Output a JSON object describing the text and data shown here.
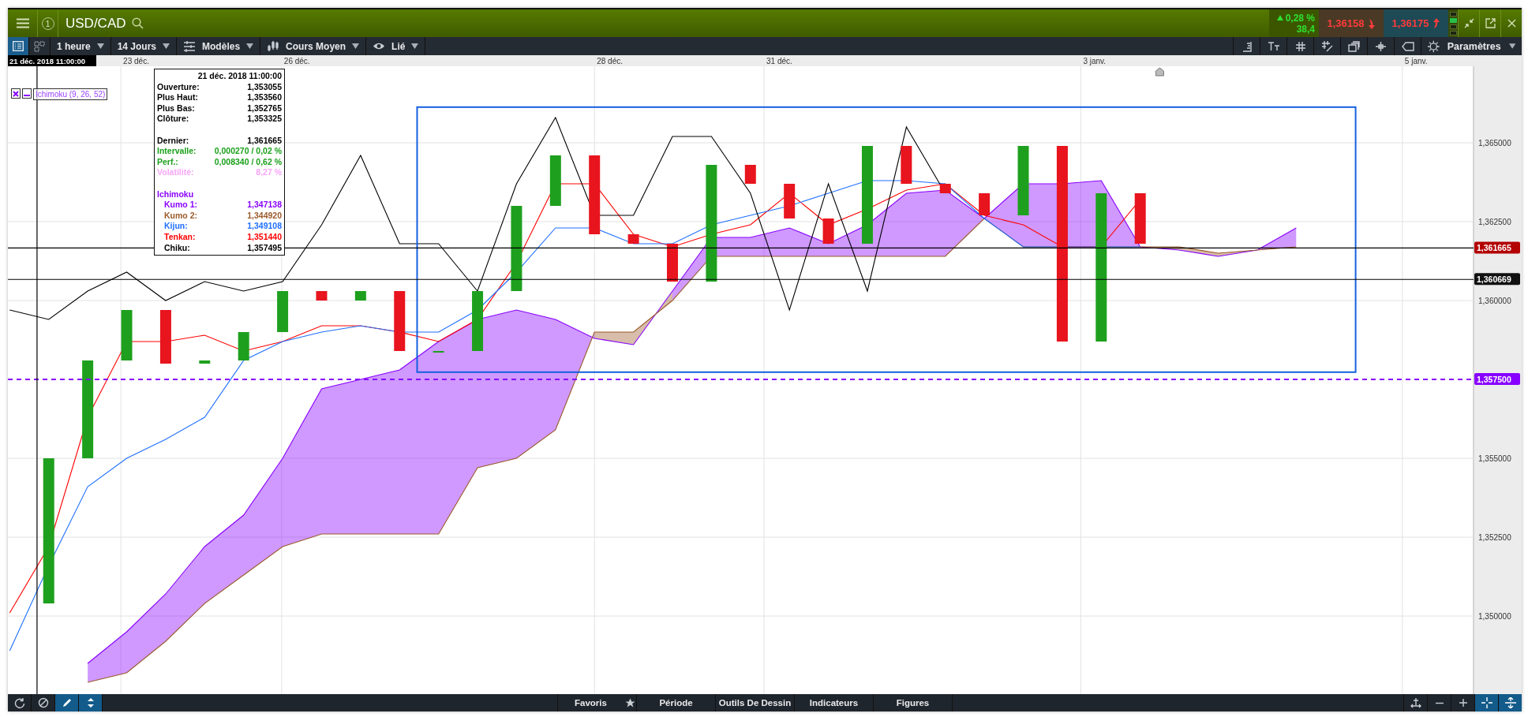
{
  "top_bar": {
    "window_number": "1",
    "symbol": "USD/CAD",
    "change": {
      "percent": "0,28 %",
      "points": "38,4"
    },
    "bid": "1,36158",
    "ask": "1,36175"
  },
  "toolbar": {
    "view_buttons": [
      {
        "selected": true
      },
      {
        "selected": false
      }
    ],
    "dropdowns": [
      {
        "label": "1 heure",
        "kind": "plain"
      },
      {
        "label": "14 Jours",
        "kind": "plain"
      },
      {
        "label": "Modèles",
        "kind": "sliders"
      },
      {
        "label": "Cours Moyen",
        "kind": "candles"
      },
      {
        "label": "Lié",
        "kind": "eye"
      }
    ],
    "tools": [
      {
        "kind": "scale"
      },
      {
        "kind": "text"
      },
      {
        "kind": "grid"
      },
      {
        "kind": "gridpen"
      },
      {
        "kind": "layers"
      },
      {
        "kind": "crosshair"
      },
      {
        "kind": "tag"
      }
    ],
    "settings": {
      "label": "Paramètres"
    }
  },
  "chart": {
    "crosshair_date": "21 déc. 2018 11:00:00",
    "date_axis": [
      "23 déc.",
      "26 déc.",
      "28 déc.",
      "31 déc.",
      "3 janv.",
      "5 janv."
    ],
    "price_axis": [
      "1,365000",
      "1,362500",
      "1,360000",
      "1,355000",
      "1,352500",
      "1,350000"
    ],
    "price_tags": [
      {
        "label": "1,361665",
        "color": "#b30000",
        "kind": "solid"
      },
      {
        "label": "1,360669",
        "color": "#111111",
        "kind": "solid"
      },
      {
        "label": "1,357500",
        "color": "#8800ff",
        "kind": "dashed"
      }
    ],
    "indicator_legend": "Ichimoku (9, 26, 52)",
    "info_panel": {
      "date": "21 déc. 2018 11:00:00",
      "sections": [
        {
          "rows": [
            {
              "label": "Ouverture:",
              "value": "1,353055",
              "color": "#000000"
            },
            {
              "label": "Plus Haut:",
              "value": "1,353560",
              "color": "#000000"
            },
            {
              "label": "Plus Bas:",
              "value": "1,352765",
              "color": "#000000"
            },
            {
              "label": "Clôture:",
              "value": "1,353325",
              "color": "#000000"
            }
          ]
        },
        {
          "rows": [
            {
              "label": "Dernier:",
              "value": "1,361665",
              "color": "#000000"
            },
            {
              "label": "Intervalle:",
              "value": "0,000270 / 0,02 %",
              "color": "#1aa01a"
            },
            {
              "label": "Perf.:",
              "value": "0,008340 / 0,62 %",
              "color": "#1aa01a"
            },
            {
              "label": "Volatilité:",
              "value": "8,27 %",
              "color": "#f7a6f7"
            }
          ]
        }
      ],
      "ichimoku": {
        "label": "Ichimoku",
        "color": "#8800ff",
        "children": [
          {
            "label": "Kumo 1:",
            "value": "1,347138",
            "color": "#8800ff"
          },
          {
            "label": "Kumo 2:",
            "value": "1,344920",
            "color": "#9b5a2a"
          },
          {
            "label": "Kijun:",
            "value": "1,349108",
            "color": "#1e6fff"
          },
          {
            "label": "Tenkan:",
            "value": "1,351440",
            "color": "#ff0000"
          },
          {
            "label": "Chiku:",
            "value": "1,357495",
            "color": "#000000"
          }
        ]
      }
    }
  },
  "bottom_bar": {
    "tools": [
      {
        "kind": "refresh",
        "selected": false
      },
      {
        "kind": "cancel",
        "selected": false
      },
      {
        "kind": "pencil",
        "selected": true
      },
      {
        "kind": "updown",
        "selected": true
      }
    ],
    "tabs": [
      {
        "label": "Favoris",
        "kind": "star"
      },
      {
        "label": "Période",
        "kind": "plain"
      },
      {
        "label": "Outils De Dessin",
        "kind": "plain"
      },
      {
        "label": "Indicateurs",
        "kind": "plain"
      },
      {
        "label": "Figures",
        "kind": "plain"
      }
    ],
    "zoom_tools": [
      {
        "kind": "move",
        "selected": false
      },
      {
        "kind": "minus",
        "selected": false
      },
      {
        "kind": "plus",
        "selected": false
      },
      {
        "kind": "cross",
        "selected": true
      },
      {
        "kind": "resize",
        "selected": true
      }
    ]
  }
}
